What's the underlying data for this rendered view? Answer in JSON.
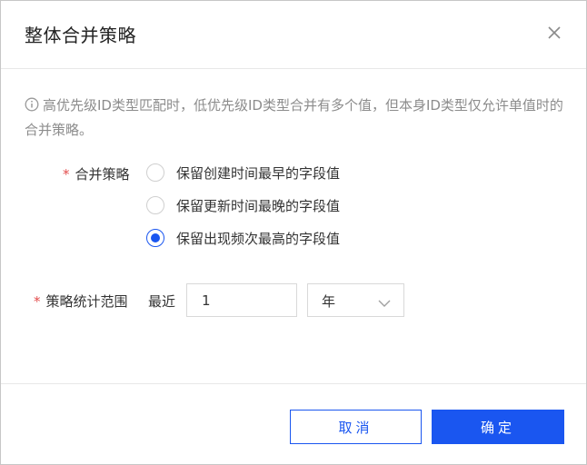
{
  "dialog": {
    "title": "整体合并策略",
    "notice": "高优先级ID类型匹配时，低优先级ID类型合并有多个值，但本身ID类型仅允许单值时的合并策略。"
  },
  "merge_strategy": {
    "label": "合并策略",
    "required_mark": "*",
    "options": [
      {
        "label": "保留创建时间最早的字段值",
        "checked": false
      },
      {
        "label": "保留更新时间最晚的字段值",
        "checked": false
      },
      {
        "label": "保留出现频次最高的字段值",
        "checked": true
      }
    ]
  },
  "range": {
    "label": "策略统计范围",
    "required_mark": "*",
    "prefix": "最近",
    "value": "1",
    "unit": "年"
  },
  "buttons": {
    "cancel": "取消",
    "ok": "确定"
  },
  "colors": {
    "primary": "#1a56f0",
    "required": "#e34d4d"
  }
}
